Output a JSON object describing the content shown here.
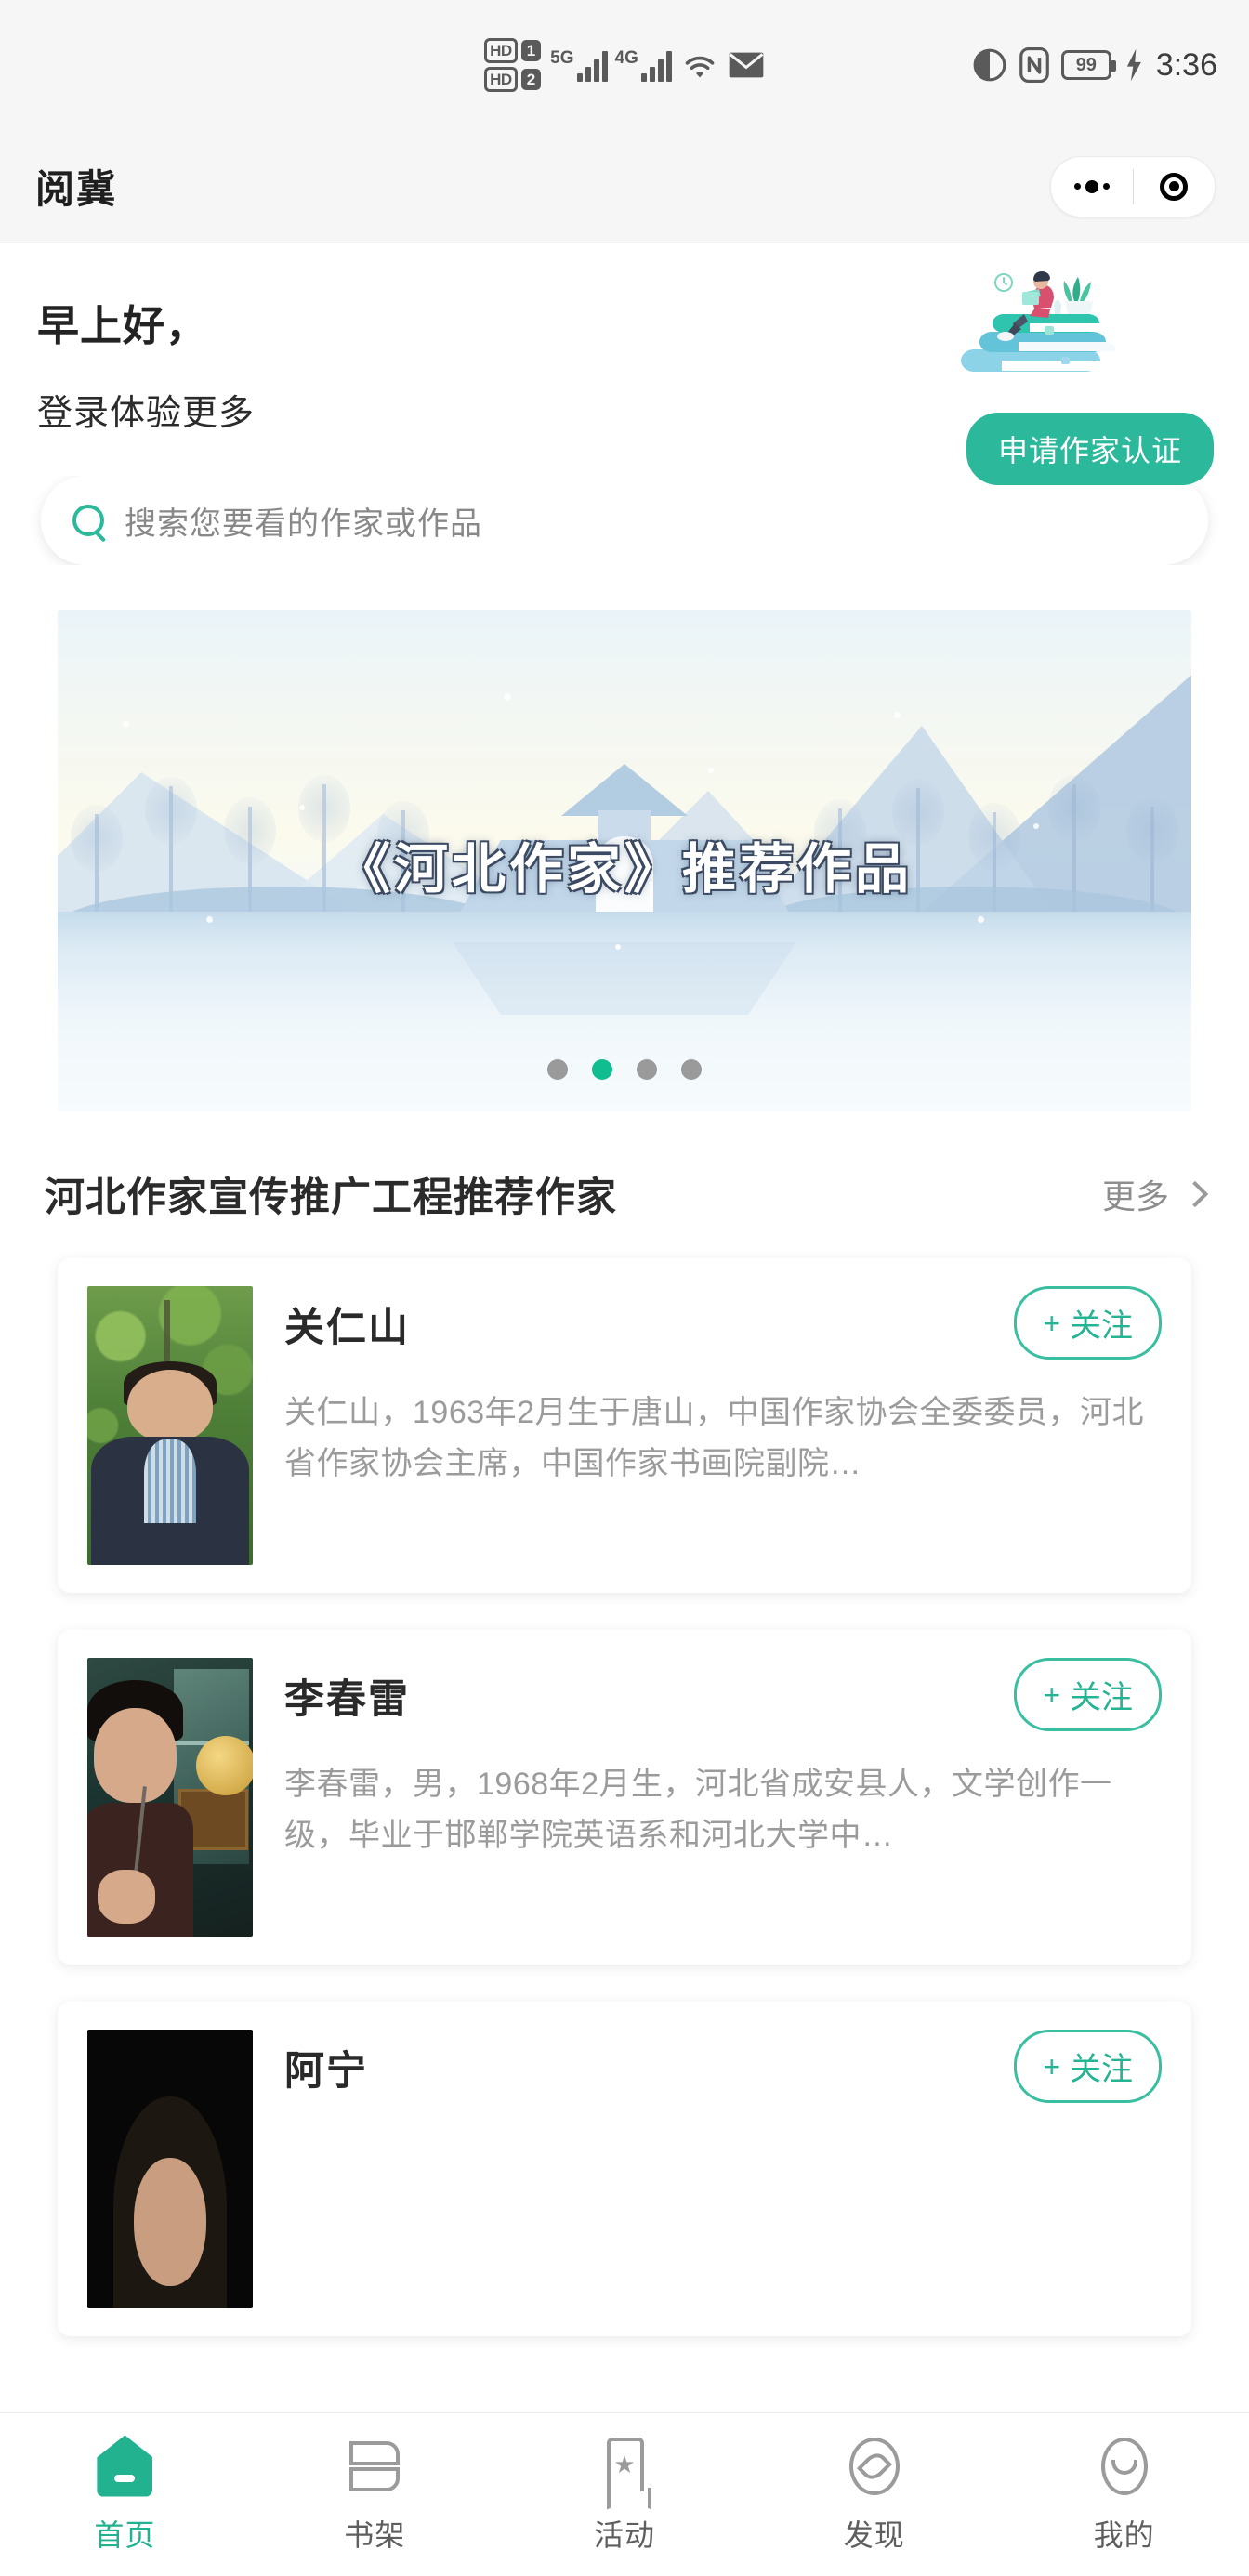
{
  "statusbar": {
    "hd_label": "HD",
    "sim1": "1",
    "sim2": "2",
    "net1": "5G",
    "net2": "4G",
    "battery": "99",
    "time": "3:36",
    "icons": [
      "hd-sim-icon",
      "signal-5g-icon",
      "signal-4g-icon",
      "wifi-icon",
      "mail-icon",
      "eye-care-icon",
      "nfc-icon",
      "battery-icon",
      "charging-bolt-icon"
    ]
  },
  "header": {
    "title": "阅冀",
    "capsule": {
      "menu_icon": "more-dots-icon",
      "close_icon": "target-circle-icon"
    }
  },
  "greeting": {
    "line1": "早上好，",
    "line2": "登录体验更多",
    "apply_button": "申请作家认证",
    "illustration": "person-reading-on-books-illustration"
  },
  "search": {
    "placeholder": "搜索您要看的作家或作品",
    "icon": "search-icon"
  },
  "banner": {
    "title": "《河北作家》推荐作品",
    "image_alt": "winter-landscape-bridge-mountains",
    "dots_total": 4,
    "dots_active_index": 1
  },
  "section": {
    "title": "河北作家宣传推广工程推荐作家",
    "more_label": "更多",
    "more_icon": "chevron-right-icon"
  },
  "authors": [
    {
      "name": "关仁山",
      "desc": "关仁山，1963年2月生于唐山，中国作家协会全委委员，河北省作家协会主席，中国作家书画院副院…",
      "follow_label": "关注",
      "follow_plus": "+",
      "avatar_class": "av-guan"
    },
    {
      "name": "李春雷",
      "desc": "李春雷，男，1968年2月生，河北省成安县人，文学创作一级，毕业于邯郸学院英语系和河北大学中…",
      "follow_label": "关注",
      "follow_plus": "+",
      "avatar_class": "av-li"
    },
    {
      "name": "阿宁",
      "desc": "",
      "follow_label": "关注",
      "follow_plus": "+",
      "avatar_class": "av-aning"
    }
  ],
  "bottom_nav": {
    "items": [
      {
        "label": "首页",
        "icon": "home-icon",
        "active": true
      },
      {
        "label": "书架",
        "icon": "bookshelf-icon",
        "active": false
      },
      {
        "label": "活动",
        "icon": "bookmark-star-icon",
        "active": false
      },
      {
        "label": "发现",
        "icon": "compass-icon",
        "active": false
      },
      {
        "label": "我的",
        "icon": "smiley-face-icon",
        "active": false
      }
    ]
  },
  "colors": {
    "accent_green": "#2CB99B",
    "nav_active": "#22B28F",
    "dot_active": "#10BD90",
    "header_bg": "#F6F6F6"
  }
}
